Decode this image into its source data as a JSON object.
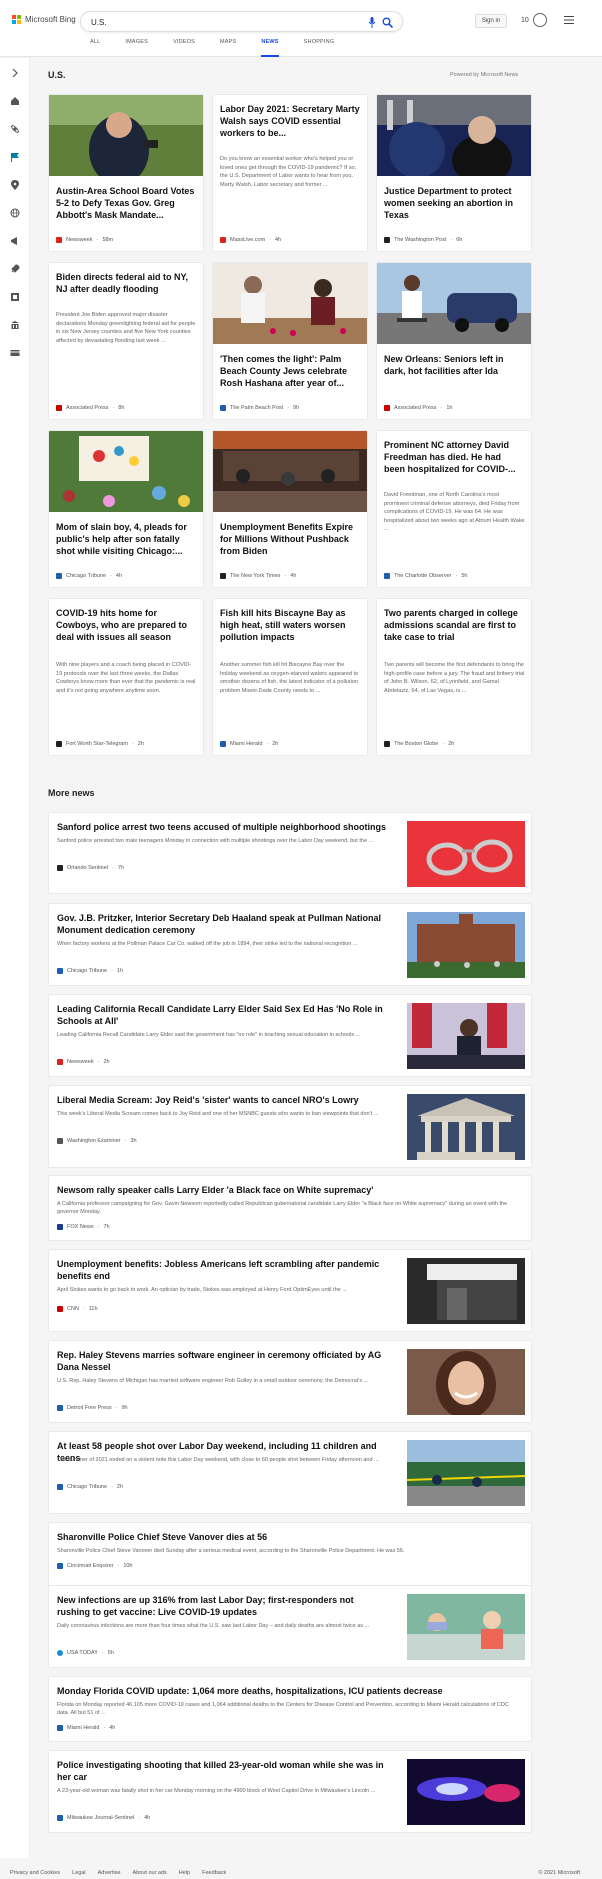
{
  "header": {
    "logo_text": "Microsoft Bing",
    "search_value": "U.S.",
    "signin_label": "Sign in",
    "rewards_count": "10"
  },
  "tabs": [
    "ALL",
    "IMAGES",
    "VIDEOS",
    "MAPS",
    "NEWS",
    "SHOPPING"
  ],
  "section": {
    "title": "U.S.",
    "powered": "Powered by Microsoft News"
  },
  "cards": [
    {
      "title": "Austin-Area School Board Votes 5-2 to Defy Texas Gov. Greg Abbott's Mask Mandate...",
      "snippet": "",
      "source": "Newsweek",
      "age": "58m",
      "color": "#d22"
    },
    {
      "title": "Labor Day 2021: Secretary Marty Walsh says COVID essential workers to be...",
      "snippet": "Do you know an essential worker who's helped you or loved ones get through the COVID-19 pandemic? If so, the U.S. Department of Labor wants to hear from you. Marty Walsh, Labor secretary and former ...",
      "source": "MassLive.com",
      "age": "4h",
      "color": "#d22"
    },
    {
      "title": "Justice Department to protect women seeking an abortion in Texas",
      "snippet": "",
      "source": "The Washington Post",
      "age": "6h",
      "color": "#222"
    },
    {
      "title": "Biden directs federal aid to NY, NJ after deadly flooding",
      "snippet": "President Joe Biden approved major disaster declarations Monday greenlighting federal aid for people in six New Jersey counties and five New York counties affected by devastating flooding last week ...",
      "source": "Associated Press",
      "age": "8h",
      "color": "#c00"
    },
    {
      "title": "'Then comes the light': Palm Beach County Jews celebrate Rosh Hashana after year of...",
      "snippet": "",
      "source": "The Palm Beach Post",
      "age": "9h",
      "color": "#1a5fb4"
    },
    {
      "title": "New Orleans: Seniors left in dark, hot facilities after Ida",
      "snippet": "",
      "source": "Associated Press",
      "age": "1h",
      "color": "#c00"
    },
    {
      "title": "Mom of slain boy, 4, pleads for public's help after son fatally shot while visiting Chicago:...",
      "snippet": "",
      "source": "Chicago Tribune",
      "age": "4h",
      "color": "#1a5fb4"
    },
    {
      "title": "Unemployment Benefits Expire for Millions Without Pushback from Biden",
      "snippet": "",
      "source": "The New York Times",
      "age": "4h",
      "color": "#222"
    },
    {
      "title": "Prominent NC attorney David Freedman has died. He had been hospitalized for COVID-...",
      "snippet": "David Freedman, one of North Carolina's most prominent criminal defense attorneys, died Friday from complications of COVID-19. He was 64. He was hospitalized about two weeks ago at Atrium Health Wake ...",
      "source": "The Charlotte Observer",
      "age": "5h",
      "color": "#1a5fb4"
    },
    {
      "title": "COVID-19 hits home for Cowboys, who are prepared to deal with issues all season",
      "snippet": "With nine players and a coach being placed in COVID-19 protocols over the last three weeks, the Dallas Cowboys know more than ever that the pandemic is real and it's not going anywhere anytime soon.",
      "source": "Fort Worth Star-Telegram",
      "age": "2h",
      "color": "#222"
    },
    {
      "title": "Fish kill hits Biscayne Bay as high heat, still waters worsen pollution impacts",
      "snippet": "Another summer fish kill hit Biscayne Bay over the holiday weekend as oxygen-starved waters appeared to smother dozens of fish, the latest indicator of a pollution problem Miami-Dade County needs to ...",
      "source": "Miami Herald",
      "age": "2h",
      "color": "#1a5fb4"
    },
    {
      "title": "Two parents charged in college admissions scandal are first to take case to trial",
      "snippet": "Two parents will become the first defendants to bring the high-profile case before a jury. The fraud and bribery trial of John B. Wilson, 62, of Lynnfield, and Gamal Abdelaziz, 64, of Las Vegas, is ...",
      "source": "The Boston Globe",
      "age": "2h",
      "color": "#222"
    }
  ],
  "more": {
    "title": "More news",
    "items": [
      {
        "title": "Sanford police arrest two teens accused of multiple neighborhood shootings",
        "snippet": "Sanford police arrested two male teenagers Monday in connection with multiple shootings over the Labor Day weekend, but the ...",
        "source": "Orlando Sentinel",
        "age": "7h",
        "color": "#222"
      },
      {
        "title": "Gov. J.B. Pritzker, Interior Secretary Deb Haaland speak at Pullman National Monument dedication ceremony",
        "snippet": "When factory workers at the Pullman Palace Car Co. walked off the job in 1894, their strike led to the national recognition ...",
        "source": "Chicago Tribune",
        "age": "1h",
        "color": "#1a5fb4"
      },
      {
        "title": "Leading California Recall Candidate Larry Elder Said Sex Ed Has 'No Role in Schools at All'",
        "snippet": "Leading California Recall Candidate Larry Elder said the government has \"no role\" in teaching sexual education in schools ...",
        "source": "Newsweek",
        "age": "2h",
        "color": "#d22"
      },
      {
        "title": "Liberal Media Scream: Joy Reid's 'sister' wants to cancel NRO's Lowry",
        "snippet": "This week's Liberal Media Scream comes back to Joy Reid and one of her MSNBC guests who wants to ban viewpoints that don't ...",
        "source": "Washington Examiner",
        "age": "3h",
        "color": "#555"
      },
      {
        "title": "Newsom rally speaker calls Larry Elder 'a Black face on White supremacy'",
        "snippet": "A California professor campaigning for Gov. Gavin Newsom reportedly called Republican gubernatorial candidate Larry Elder \"a Black face on White supremacy\" during an event with the governor Monday.",
        "source": "FOX News",
        "age": "7h",
        "color": "#1a3b8f"
      },
      {
        "title": "Unemployment benefits: Jobless Americans left scrambling after pandemic benefits end",
        "snippet": "April Stokes wants to go back to work. An optician by trade, Stokes was employed at Henry Ford OptimEyes until the ...",
        "source": "CNN",
        "age": "11h",
        "color": "#c00"
      },
      {
        "title": "Rep. Haley Stevens marries software engineer in ceremony officiated by AG Dana Nessel",
        "snippet": "U.S. Rep. Haley Stevens of Michigan has married software engineer Rob Gulley in a small outdoor ceremony, the Democrat's ...",
        "source": "Detroit Free Press",
        "age": "9h",
        "color": "#1a5fb4"
      },
      {
        "title": "At least 58 people shot over Labor Day weekend, including 11 children and teens",
        "snippet": "The summer of 2021 ended on a violent note this Labor Day weekend, with close to 60 people shot between Friday afternoon and ...",
        "source": "Chicago Tribune",
        "age": "2h",
        "color": "#1a5fb4"
      },
      {
        "title": "Sharonville Police Chief Steve Vanover dies at 56",
        "snippet": "Sharonville Police Chief Steve Vanover died Sunday after a serious medical event, according to the Sharonville Police Department. He was 56.",
        "source": "Cincinnati Enquirer",
        "age": "10h",
        "color": "#1a5fb4"
      },
      {
        "title": "New infections are up 316% from last Labor Day; first-responders not rushing to get vaccine: Live COVID-19 updates",
        "snippet": "Daily coronavirus infections are more than four times what the U.S. saw last Labor Day – and daily deaths are almost twice as ...",
        "source": "USA TODAY",
        "age": "5h",
        "color": "#1a8fe0"
      },
      {
        "title": "Monday Florida COVID update: 1,064 more deaths, hospitalizations, ICU patients decrease",
        "snippet": "Florida on Monday reported 46,105 more COVID-19 cases and 1,064 additional deaths to the Centers for Disease Control and Prevention, according to Miami Herald calculations of CDC data. All but 51 of ...",
        "source": "Miami Herald",
        "age": "4h",
        "color": "#1a5fb4"
      },
      {
        "title": "Police investigating shooting that killed 23-year-old woman while she was in her car",
        "snippet": "A 23-year-old woman was fatally shot in her car Monday morning on the 4900 block of West Capitol Drive in Milwaukee's Lincoln ...",
        "source": "Milwaukee Journal-Sentinel",
        "age": "4h",
        "color": "#1a5fb4"
      }
    ]
  },
  "footer": {
    "links": [
      "Privacy and Cookies",
      "Legal",
      "Advertise",
      "About our ads",
      "Help",
      "Feedback"
    ],
    "copyright": "© 2021 Microsoft"
  }
}
